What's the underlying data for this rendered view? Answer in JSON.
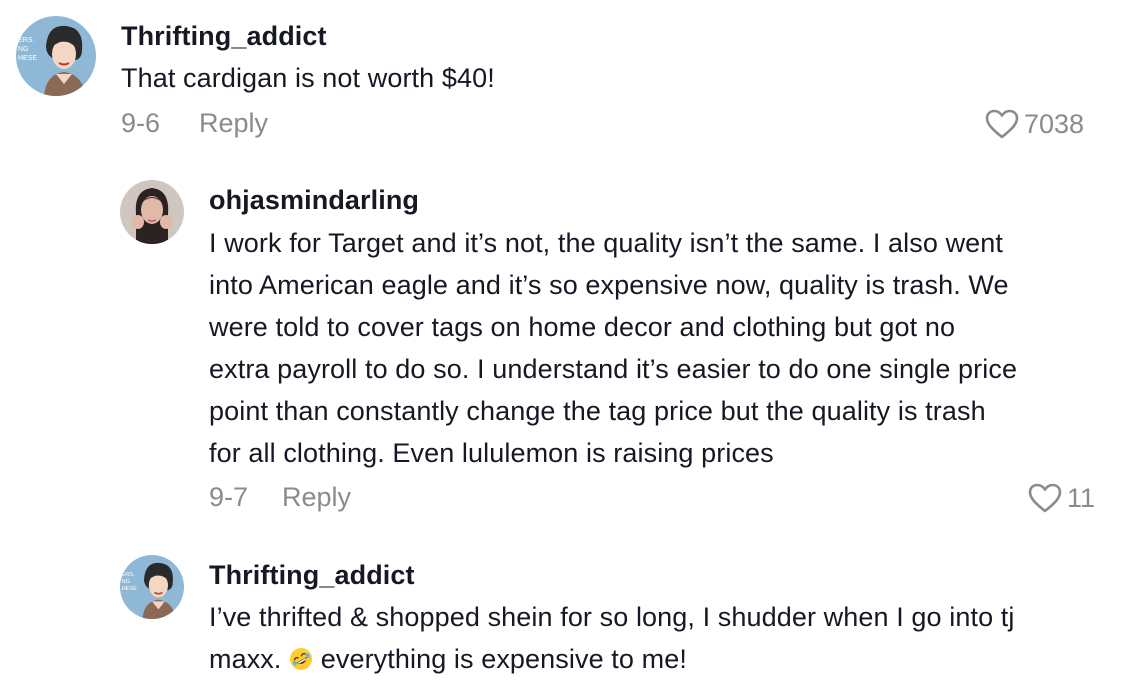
{
  "comments": [
    {
      "username": "Thrifting_addict",
      "text": "That cardigan is not worth $40!",
      "date": "9-6",
      "reply_label": "Reply",
      "likes": "7038",
      "avatar_text": "ERS. NG HESE"
    },
    {
      "username": "ohjasmindarling",
      "text_lines": [
        "I work for Target and it’s not, the quality isn’t the same. I also went",
        "into American eagle and it’s so expensive now, quality is trash. We",
        "were told to cover tags on home decor and clothing but got no",
        "extra payroll to do so. I understand it’s easier to do one single price",
        "point than constantly change the tag price but the quality is trash",
        "for all clothing. Even lululemon is raising prices"
      ],
      "date": "9-7",
      "reply_label": "Reply",
      "likes": "11"
    },
    {
      "username": "Thrifting_addict",
      "text_line1": "I’ve thrifted & shopped shein for so long, I shudder when I go into tj",
      "text_line2_a": "maxx.",
      "emoji_name": "rolling-on-floor-laughing-emoji",
      "text_line2_b": "everything is expensive to me!",
      "avatar_text": "ERS. NG HESE"
    }
  ],
  "colors": {
    "primary_text": "#161823",
    "secondary_text": "#8a8b91",
    "avatar_bg": "#8fb7d6"
  }
}
